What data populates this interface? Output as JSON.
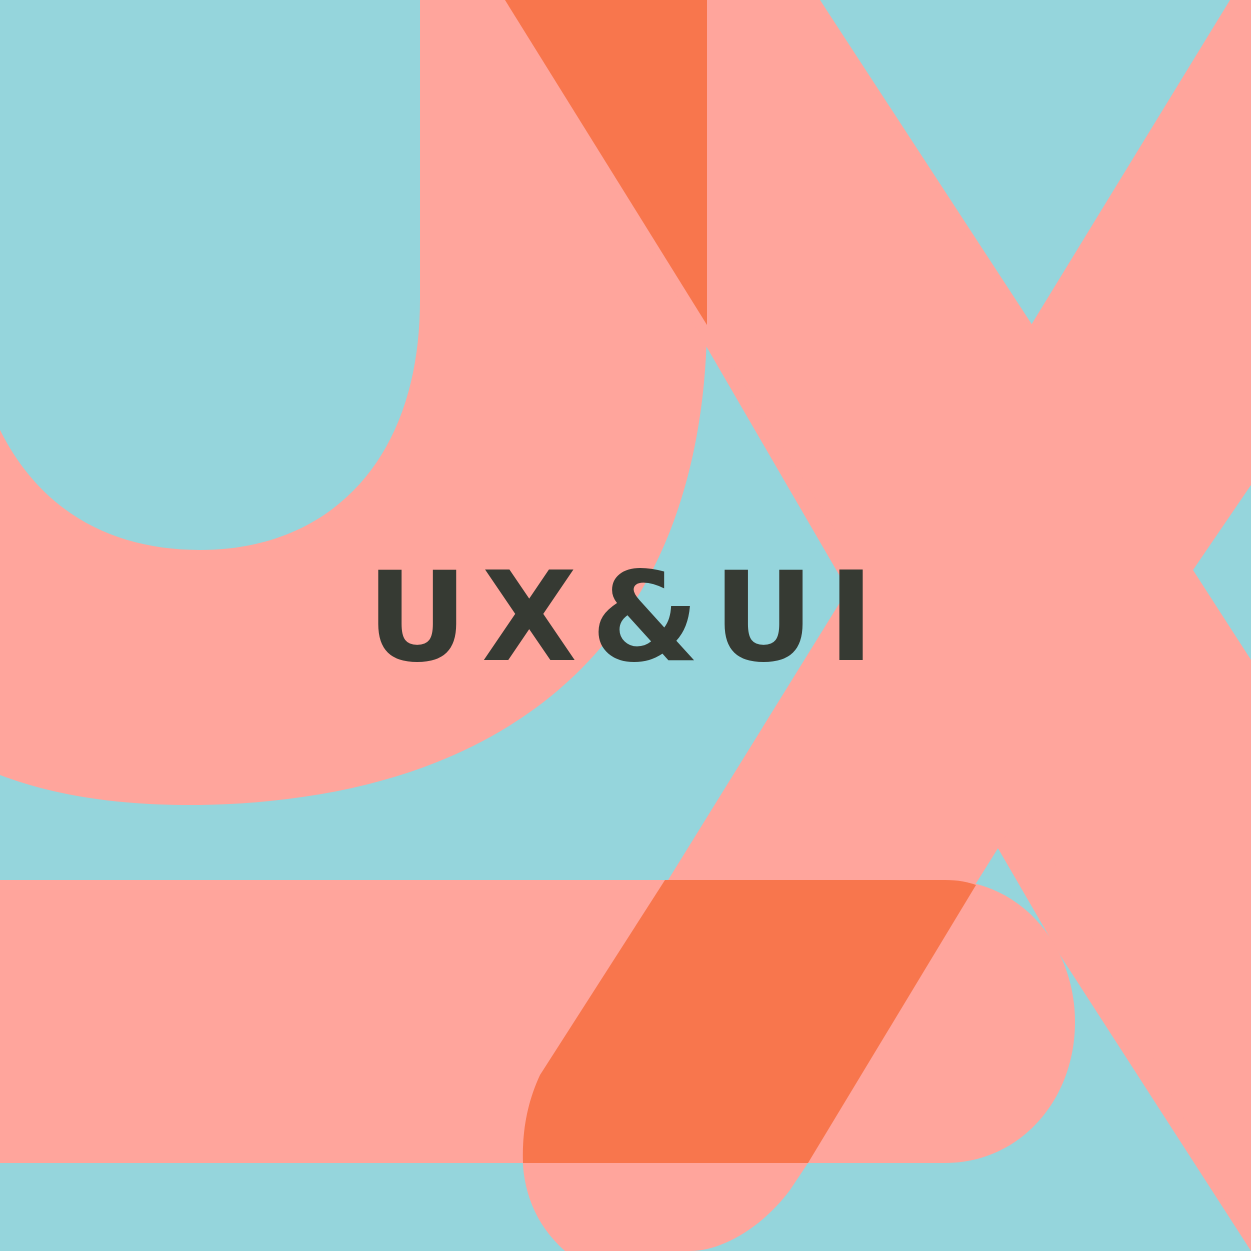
{
  "poster": {
    "title": "UX&UI"
  },
  "colors": {
    "background": "#95D5DC",
    "pink": "#FFA59C",
    "orange": "#F8764D",
    "text": "#363A33"
  }
}
